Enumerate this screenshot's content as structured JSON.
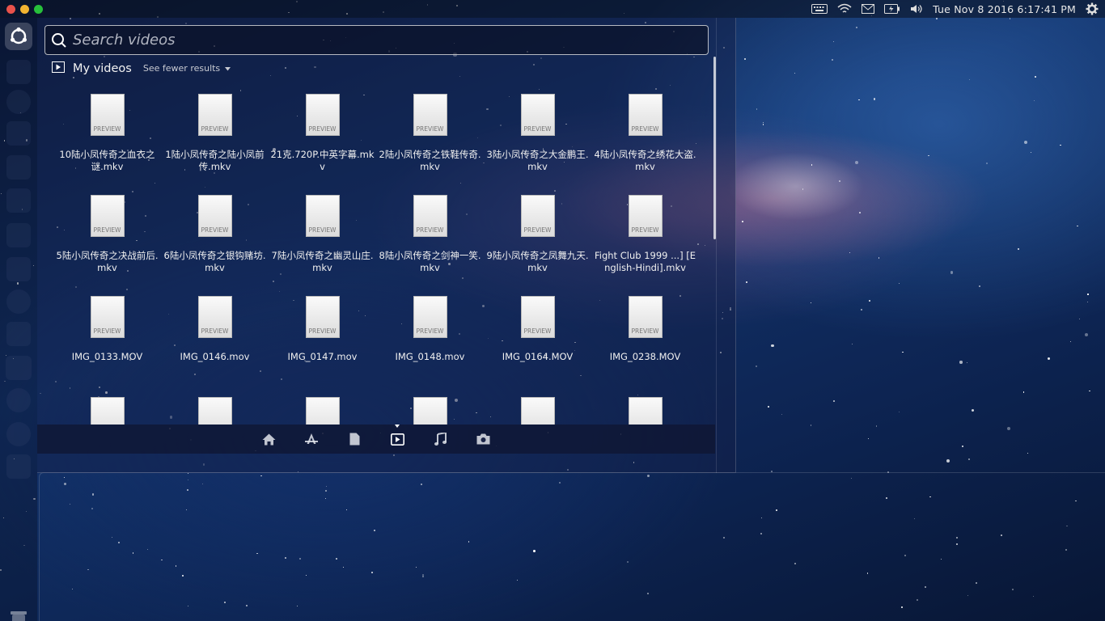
{
  "window_controls": {
    "close_color": "#e9524b",
    "minimize_color": "#f2b431",
    "maximize_color": "#27c03b"
  },
  "panel": {
    "clock": "Tue Nov  8 2016  6:17:41 PM",
    "indicators": [
      "keyboard-icon",
      "wifi-icon",
      "mail-icon",
      "battery-icon",
      "volume-icon",
      "gear-icon"
    ]
  },
  "launcher": {
    "items": [
      "files-icon",
      "browser-icon",
      "photos-icon",
      "text-editor-icon",
      "document-icon",
      "terminal-icon",
      "calendar-icon",
      "tool-icon",
      "chart-icon",
      "panel-icon",
      "moon-icon",
      "monitor-icon",
      "workspace-icon"
    ],
    "trash": "trash-icon"
  },
  "dash": {
    "search": {
      "placeholder": "Search videos",
      "value": ""
    },
    "category": {
      "title": "My videos",
      "toggle_label": "See fewer results"
    },
    "results": [
      {
        "label": "10陆小凤传奇之血衣之谜.mkv",
        "thumb_text": "PREVIEW"
      },
      {
        "label": "1陆小凤传奇之陆小凤前传.mkv",
        "thumb_text": "PREVIEW"
      },
      {
        "label": "21克.720P.中英字幕.mkv",
        "thumb_text": "PREVIEW"
      },
      {
        "label": "2陆小凤传奇之铁鞋传奇.mkv",
        "thumb_text": "PREVIEW"
      },
      {
        "label": "3陆小凤传奇之大金鹏王.mkv",
        "thumb_text": "PREVIEW"
      },
      {
        "label": "4陆小凤传奇之绣花大盗.mkv",
        "thumb_text": "PREVIEW"
      },
      {
        "label": "5陆小凤传奇之决战前后.mkv",
        "thumb_text": "PREVIEW"
      },
      {
        "label": "6陆小凤传奇之银钩赌坊.mkv",
        "thumb_text": "PREVIEW"
      },
      {
        "label": "7陆小凤传奇之幽灵山庄.mkv",
        "thumb_text": "PREVIEW"
      },
      {
        "label": "8陆小凤传奇之剑神一笑.mkv",
        "thumb_text": "PREVIEW"
      },
      {
        "label": "9陆小凤传奇之凤舞九天.mkv",
        "thumb_text": "PREVIEW"
      },
      {
        "label": "Fight Club 1999 ...] [English-Hindi].mkv",
        "thumb_text": "PREVIEW"
      },
      {
        "label": "IMG_0133.MOV",
        "thumb_text": "PREVIEW"
      },
      {
        "label": "IMG_0146.mov",
        "thumb_text": "PREVIEW"
      },
      {
        "label": "IMG_0147.mov",
        "thumb_text": "PREVIEW"
      },
      {
        "label": "IMG_0148.mov",
        "thumb_text": "PREVIEW"
      },
      {
        "label": "IMG_0164.MOV",
        "thumb_text": "PREVIEW"
      },
      {
        "label": "IMG_0238.MOV",
        "thumb_text": "PREVIEW"
      },
      {
        "label": "",
        "thumb_text": ""
      },
      {
        "label": "",
        "thumb_text": ""
      },
      {
        "label": "",
        "thumb_text": ""
      },
      {
        "label": "",
        "thumb_text": ""
      },
      {
        "label": "",
        "thumb_text": ""
      },
      {
        "label": "",
        "thumb_text": ""
      }
    ],
    "lenses": [
      "home-icon",
      "applications-icon",
      "files-icon",
      "video-icon",
      "music-icon",
      "photo-icon"
    ],
    "active_lens": "video-icon"
  }
}
